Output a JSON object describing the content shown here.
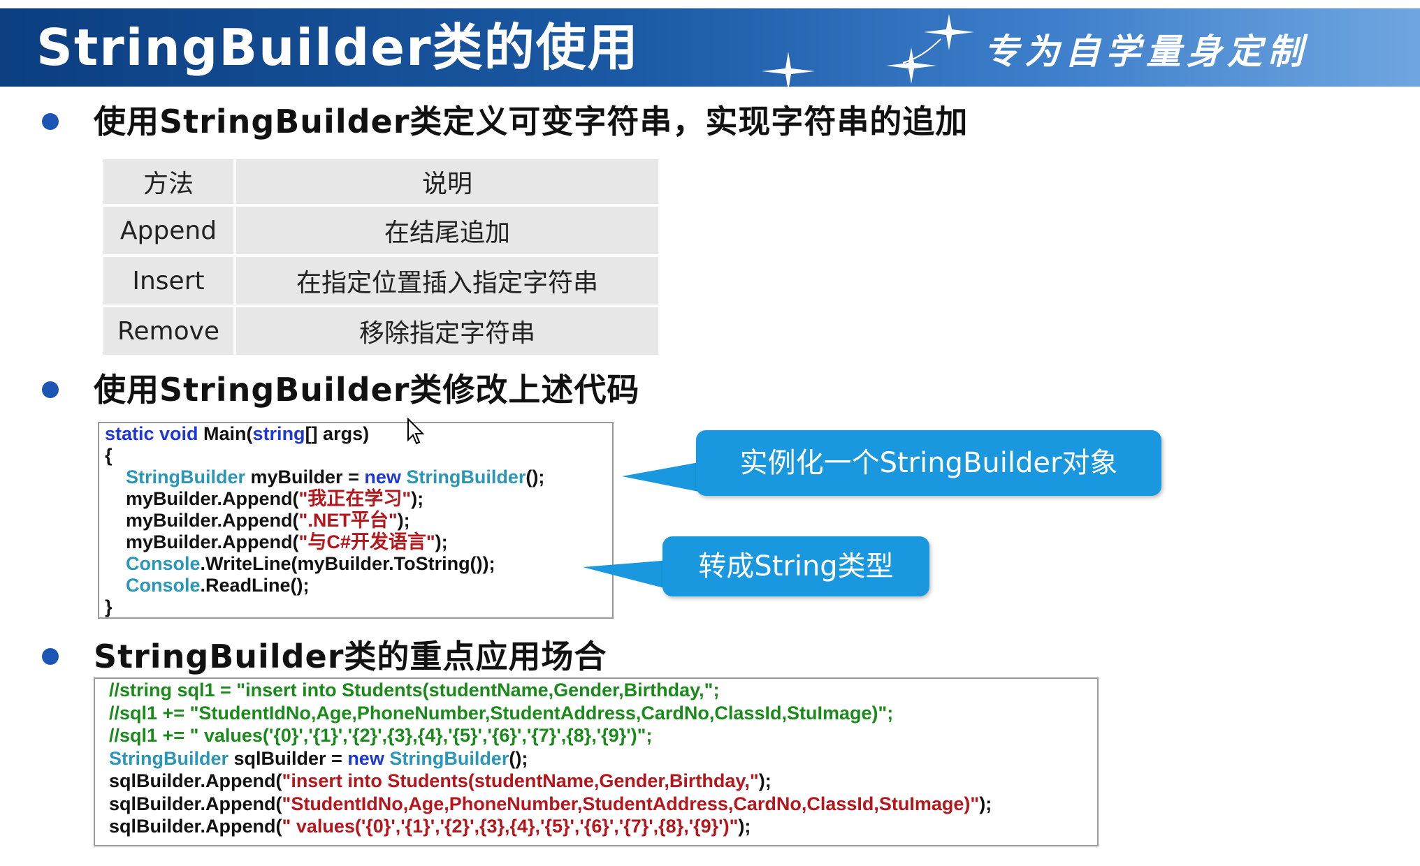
{
  "header": {
    "title": "StringBuilder类的使用",
    "slogan": "专为自学量身定制"
  },
  "sections": [
    {
      "text": "使用StringBuilder类定义可变字符串，实现字符串的追加"
    },
    {
      "text": "使用StringBuilder类修改上述代码"
    },
    {
      "text": "StringBuilder类的重点应用场合"
    }
  ],
  "method_table": {
    "headers": [
      "方法",
      "说明"
    ],
    "rows": [
      [
        "Append",
        "在结尾追加"
      ],
      [
        "Insert",
        "在指定位置插入指定字符串"
      ],
      [
        "Remove",
        "移除指定字符串"
      ]
    ]
  },
  "code1": {
    "lines": [
      [
        {
          "t": "static void ",
          "c": "kw"
        },
        {
          "t": "Main("
        },
        {
          "t": "string",
          "c": "kw"
        },
        {
          "t": "[] args)"
        }
      ],
      [
        {
          "t": "{"
        }
      ],
      [
        {
          "t": "    "
        },
        {
          "t": "StringBuilder",
          "c": "ty"
        },
        {
          "t": " myBuilder = "
        },
        {
          "t": "new ",
          "c": "kw"
        },
        {
          "t": "StringBuilder",
          "c": "ty"
        },
        {
          "t": "();"
        }
      ],
      [
        {
          "t": "    myBuilder.Append("
        },
        {
          "t": "\"我正在学习\"",
          "c": "str"
        },
        {
          "t": ");"
        }
      ],
      [
        {
          "t": "    myBuilder.Append("
        },
        {
          "t": "\".NET平台\"",
          "c": "str"
        },
        {
          "t": ");"
        }
      ],
      [
        {
          "t": "    myBuilder.Append("
        },
        {
          "t": "\"与C#开发语言\"",
          "c": "str"
        },
        {
          "t": ");"
        }
      ],
      [
        {
          "t": "    "
        },
        {
          "t": "Console",
          "c": "ty"
        },
        {
          "t": ".WriteLine(myBuilder.ToString());"
        }
      ],
      [
        {
          "t": "    "
        },
        {
          "t": "Console",
          "c": "ty"
        },
        {
          "t": ".ReadLine();"
        }
      ],
      [
        {
          "t": "}"
        }
      ]
    ]
  },
  "code2": {
    "lines": [
      [
        {
          "t": "//string sql1 = \"insert into Students(studentName,Gender,Birthday,\";",
          "c": "cm"
        }
      ],
      [
        {
          "t": "//sql1 += \"StudentIdNo,Age,PhoneNumber,StudentAddress,CardNo,ClassId,StuImage)\";",
          "c": "cm"
        }
      ],
      [
        {
          "t": "//sql1 += \" values('{0}','{1}','{2}',{3},{4},'{5}','{6}','{7}',{8},'{9}')\";",
          "c": "cm"
        }
      ],
      [
        {
          "t": "StringBuilder",
          "c": "ty"
        },
        {
          "t": " sqlBuilder = "
        },
        {
          "t": "new ",
          "c": "kw"
        },
        {
          "t": "StringBuilder",
          "c": "ty"
        },
        {
          "t": "();"
        }
      ],
      [
        {
          "t": "sqlBuilder.Append("
        },
        {
          "t": "\"insert into Students(studentName,Gender,Birthday,\"",
          "c": "str"
        },
        {
          "t": ");"
        }
      ],
      [
        {
          "t": "sqlBuilder.Append("
        },
        {
          "t": "\"StudentIdNo,Age,PhoneNumber,StudentAddress,CardNo,ClassId,StuImage)\"",
          "c": "str"
        },
        {
          "t": ");"
        }
      ],
      [
        {
          "t": "sqlBuilder.Append("
        },
        {
          "t": "\" values('{0}','{1}','{2}',{3},{4},'{5}','{6}','{7}',{8},'{9}')\"",
          "c": "str"
        },
        {
          "t": ");"
        }
      ]
    ]
  },
  "callouts": {
    "instantiate": "实例化一个StringBuilder对象",
    "tostring": "转成String类型"
  },
  "colors": {
    "header_dark": "#0c3e80",
    "header_light": "#6fa6e0",
    "bullet": "#1c56b4",
    "callout": "#1998df",
    "keyword": "#1e38d6",
    "type": "#2a96b8",
    "string": "#b5161b",
    "comment": "#1a8a1a"
  }
}
